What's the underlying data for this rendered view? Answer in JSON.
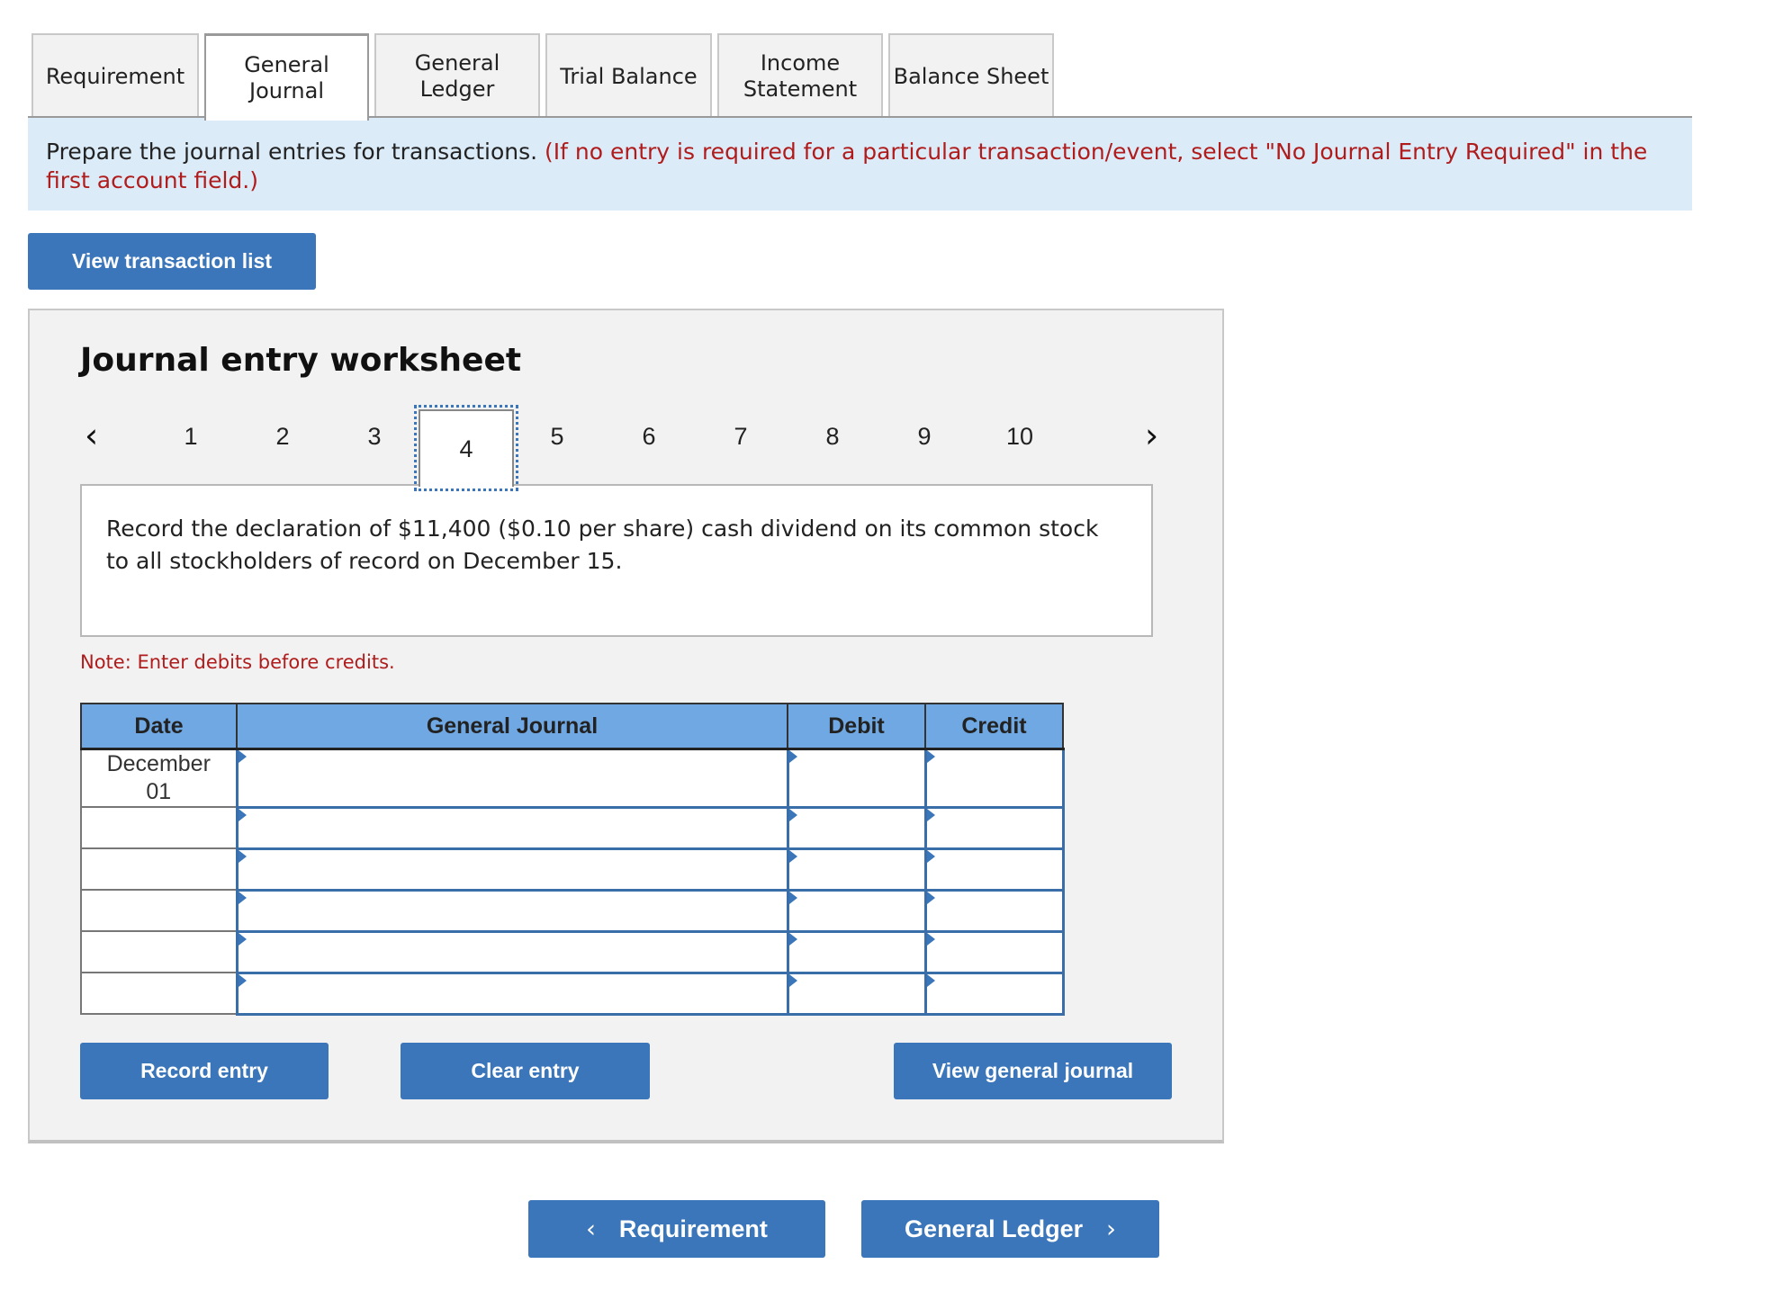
{
  "tabs": [
    {
      "label": "Requirement",
      "active": false
    },
    {
      "label": "General\nJournal",
      "active": true
    },
    {
      "label": "General\nLedger",
      "active": false
    },
    {
      "label": "Trial Balance",
      "active": false
    },
    {
      "label": "Income\nStatement",
      "active": false
    },
    {
      "label": "Balance Sheet",
      "active": false
    }
  ],
  "banner": {
    "instruction": "Prepare the journal entries for transactions. ",
    "note": "(If no entry is required for a particular transaction/event, select \"No Journal Entry Required\" in the first account field.)"
  },
  "view_transaction_list_label": "View transaction list",
  "worksheet": {
    "title": "Journal entry worksheet",
    "pager": {
      "prev_icon": "chevron-left-icon",
      "next_icon": "chevron-right-icon",
      "pages": [
        "1",
        "2",
        "3",
        "4",
        "5",
        "6",
        "7",
        "8",
        "9",
        "10"
      ],
      "active_page": "4"
    },
    "description": "Record the declaration of $11,400 ($0.10 per share) cash dividend on its common stock to all stockholders of record on December 15.",
    "note": "Note: Enter debits before credits.",
    "table": {
      "headers": {
        "date": "Date",
        "journal": "General Journal",
        "debit": "Debit",
        "credit": "Credit"
      },
      "rows": [
        {
          "date": "December\n01",
          "account": "",
          "debit": "",
          "credit": ""
        },
        {
          "date": "",
          "account": "",
          "debit": "",
          "credit": ""
        },
        {
          "date": "",
          "account": "",
          "debit": "",
          "credit": ""
        },
        {
          "date": "",
          "account": "",
          "debit": "",
          "credit": ""
        },
        {
          "date": "",
          "account": "",
          "debit": "",
          "credit": ""
        },
        {
          "date": "",
          "account": "",
          "debit": "",
          "credit": ""
        }
      ]
    },
    "buttons": {
      "record": "Record entry",
      "clear": "Clear entry",
      "view_gj": "View general journal"
    }
  },
  "nav": {
    "prev_label": "Requirement",
    "next_label": "General Ledger"
  },
  "colors": {
    "accent": "#3a76b9",
    "header_blue": "#6fa8e2",
    "banner_bg": "#dbebf8",
    "note_red": "#b01c1c"
  }
}
